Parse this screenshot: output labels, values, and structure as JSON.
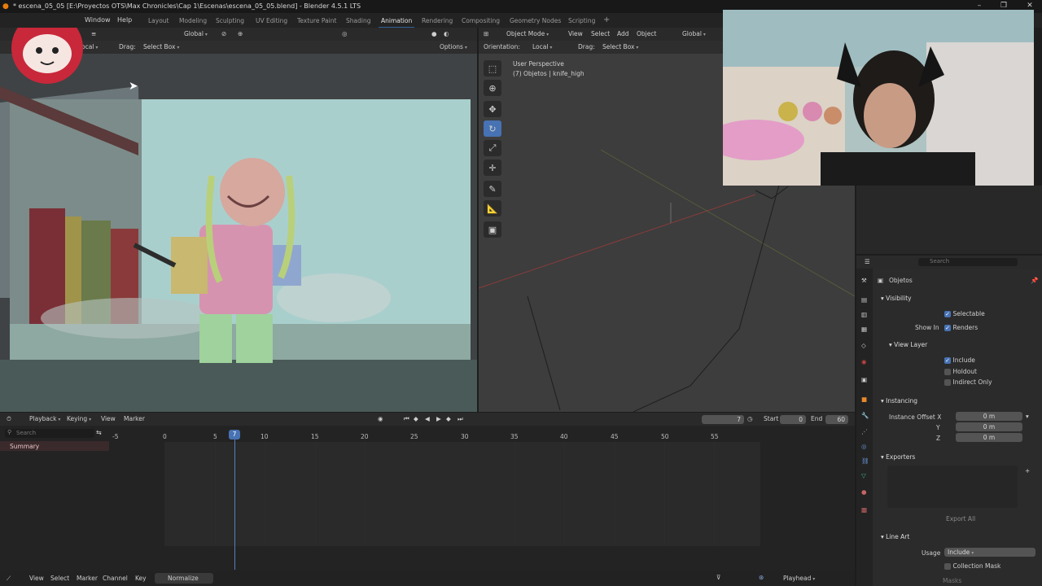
{
  "window": {
    "title": "* escena_05_05 [E:\\Proyectos OTS\\Max Chronicles\\Cap 1\\Escenas\\escena_05_05.blend] - Blender 4.5.1 LTS"
  },
  "menu": {
    "window": "Window",
    "help": "Help"
  },
  "workspaces": [
    "Layout",
    "Modeling",
    "Sculpting",
    "UV Editing",
    "Texture Paint",
    "Shading",
    "Animation",
    "Rendering",
    "Compositing",
    "Geometry Nodes",
    "Scripting"
  ],
  "workspace_add": "+",
  "left_viewport": {
    "orientation": "Global",
    "orient_partial": "ocal",
    "drag_label": "Drag:",
    "drag_value": "Select Box",
    "options": "Options"
  },
  "right_viewport": {
    "mode": "Object Mode",
    "menu": [
      "View",
      "Select",
      "Add",
      "Object"
    ],
    "orientation_global": "Global",
    "orientation_label": "Orientation:",
    "orientation_value": "Local",
    "drag_label": "Drag:",
    "drag_value": "Select Box",
    "info_line1": "User Perspective",
    "info_line2": "(7) Objetos | knife_high"
  },
  "timeline": {
    "menu": [
      "Playback",
      "Keying",
      "View",
      "Marker"
    ],
    "current_frame": "7",
    "start_label": "Start",
    "start_value": "0",
    "end_label": "End",
    "end_value": "60",
    "search_placeholder": "Search",
    "summary": "Summary",
    "ticks": [
      "-5",
      "0",
      "5",
      "7",
      "10",
      "15",
      "20",
      "25",
      "30",
      "35",
      "40",
      "45",
      "50",
      "55"
    ]
  },
  "status": {
    "menu": [
      "View",
      "Select",
      "Marker",
      "Channel",
      "Key"
    ],
    "normalize": "Normalize",
    "playhead": "Playhead"
  },
  "properties": {
    "search_placeholder": "Search",
    "object_name": "Objetos",
    "visibility": "Visibility",
    "selectable": "Selectable",
    "show_in": "Show In",
    "renders": "Renders",
    "view_layer": "View Layer",
    "include": "Include",
    "holdout": "Holdout",
    "indirect_only": "Indirect Only",
    "instancing": "Instancing",
    "instance_offset_x": "Instance Offset X",
    "y": "Y",
    "z": "Z",
    "offset_x": "0 m",
    "offset_y": "0 m",
    "offset_z": "0 m",
    "exporters": "Exporters",
    "export_all": "Export All",
    "line_art": "Line Art",
    "usage_label": "Usage",
    "usage_value": "Include",
    "collection_mask": "Collection Mask",
    "masks": "Masks"
  },
  "colors": {
    "accent": "#4772b3",
    "playhead": "#5680c2"
  }
}
